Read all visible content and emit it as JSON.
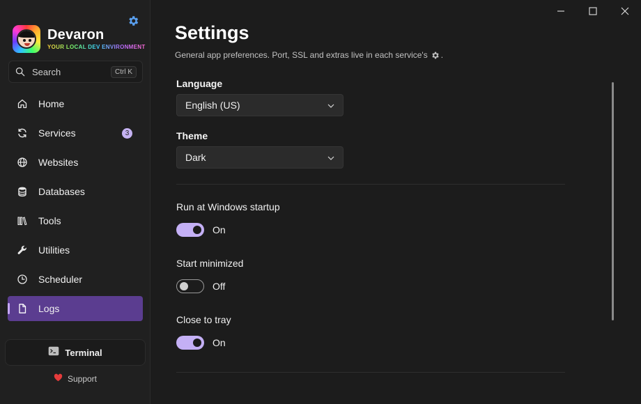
{
  "app": {
    "name": "Devaron",
    "tagline": "YOUR LOCAL DEV ENVIRONMENT"
  },
  "search": {
    "label": "Search",
    "shortcut": "Ctrl K"
  },
  "nav": [
    {
      "label": "Home",
      "icon": "home-icon"
    },
    {
      "label": "Services",
      "icon": "services-icon",
      "badge": "3"
    },
    {
      "label": "Websites",
      "icon": "globe-icon"
    },
    {
      "label": "Databases",
      "icon": "database-icon"
    },
    {
      "label": "Tools",
      "icon": "tools-icon"
    },
    {
      "label": "Utilities",
      "icon": "wrench-icon"
    },
    {
      "label": "Scheduler",
      "icon": "clock-icon"
    },
    {
      "label": "Logs",
      "icon": "document-icon",
      "active": true
    }
  ],
  "footer": {
    "terminal_label": "Terminal",
    "support_label": "Support"
  },
  "page": {
    "title": "Settings",
    "subtitle": "General app preferences. Port, SSL and extras live in each service's",
    "subtitle_end": "."
  },
  "settings": {
    "language": {
      "label": "Language",
      "value": "English (US)"
    },
    "theme": {
      "label": "Theme",
      "value": "Dark"
    },
    "run_at_startup": {
      "label": "Run at Windows startup",
      "state": "On"
    },
    "start_minimized": {
      "label": "Start minimized",
      "state": "Off"
    },
    "close_to_tray": {
      "label": "Close to tray",
      "state": "On"
    }
  },
  "colors": {
    "accent": "#c4b0f5",
    "active_nav": "#5b3d90",
    "settings_gear": "#5aa0f0",
    "support_heart": "#e53b3b",
    "background": "#1c1c1c",
    "sidebar": "#202020"
  }
}
